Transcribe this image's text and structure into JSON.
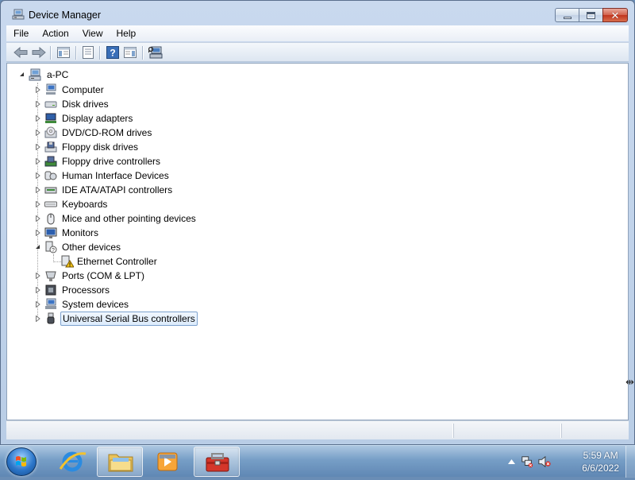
{
  "window": {
    "title": "Device Manager",
    "caption_buttons": {
      "minimize": "minimize",
      "maximize": "maximize",
      "close": "✕"
    }
  },
  "menu": [
    "File",
    "Action",
    "View",
    "Help"
  ],
  "toolbar": {
    "buttons": [
      "back-arrow-icon",
      "forward-arrow-icon",
      "show-hide-console-tree-icon",
      "properties-icon",
      "help-icon",
      "show-action-pane-icon",
      "scan-hardware-icon"
    ]
  },
  "tree": {
    "root": "a-PC",
    "categories": [
      {
        "label": "Computer",
        "icon": "computer-icon",
        "expanded": false
      },
      {
        "label": "Disk drives",
        "icon": "disk-drive-icon",
        "expanded": false
      },
      {
        "label": "Display adapters",
        "icon": "display-adapter-icon",
        "expanded": false
      },
      {
        "label": "DVD/CD-ROM drives",
        "icon": "dvd-drive-icon",
        "expanded": false
      },
      {
        "label": "Floppy disk drives",
        "icon": "floppy-drive-icon",
        "expanded": false
      },
      {
        "label": "Floppy drive controllers",
        "icon": "floppy-controller-icon",
        "expanded": false
      },
      {
        "label": "Human Interface Devices",
        "icon": "hid-icon",
        "expanded": false
      },
      {
        "label": "IDE ATA/ATAPI controllers",
        "icon": "ide-controller-icon",
        "expanded": false
      },
      {
        "label": "Keyboards",
        "icon": "keyboard-icon",
        "expanded": false
      },
      {
        "label": "Mice and other pointing devices",
        "icon": "mouse-icon",
        "expanded": false
      },
      {
        "label": "Monitors",
        "icon": "monitor-icon",
        "expanded": false
      },
      {
        "label": "Other devices",
        "icon": "unknown-device-icon",
        "expanded": true,
        "children": [
          {
            "label": "Ethernet Controller",
            "icon": "warning-device-icon"
          }
        ]
      },
      {
        "label": "Ports (COM & LPT)",
        "icon": "port-icon",
        "expanded": false
      },
      {
        "label": "Processors",
        "icon": "processor-icon",
        "expanded": false
      },
      {
        "label": "System devices",
        "icon": "system-device-icon",
        "expanded": false
      },
      {
        "label": "Universal Serial Bus controllers",
        "icon": "usb-icon",
        "expanded": false,
        "selected": true
      }
    ]
  },
  "taskbar": {
    "apps": [
      "internet-explorer-icon",
      "windows-explorer-icon",
      "media-player-icon",
      "device-manager-toolbox-icon"
    ],
    "active_app": "device-manager-toolbox-icon",
    "tray_icons": [
      "show-hidden-icons-arrow",
      "network-icon",
      "volume-muted-icon"
    ],
    "clock_time": "5:59 AM",
    "clock_date": "6/6/2022"
  },
  "colors": {
    "selection_border": "#7da2ce",
    "taskbar": "#5f87b4",
    "close_button": "#c0351e"
  }
}
